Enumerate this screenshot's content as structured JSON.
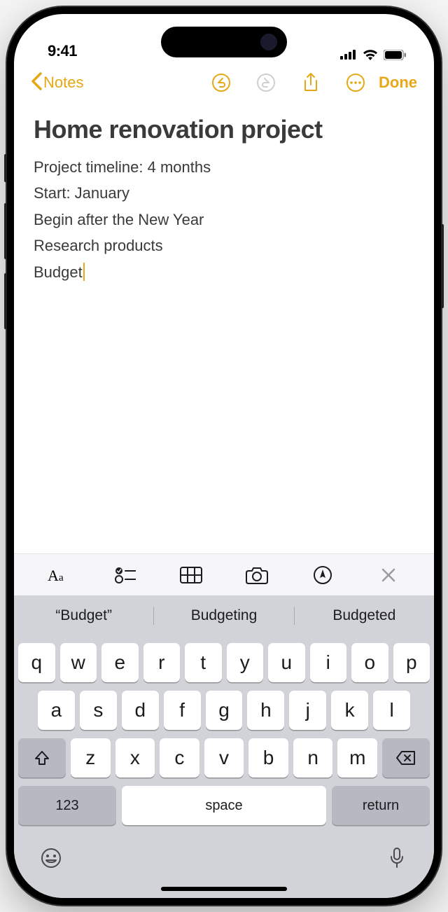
{
  "status": {
    "time": "9:41"
  },
  "nav": {
    "back_label": "Notes",
    "done_label": "Done"
  },
  "note": {
    "title": "Home renovation project",
    "lines": [
      "Project timeline: 4 months",
      "Start: January",
      "Begin after the New Year",
      "Research products",
      "Budget"
    ]
  },
  "suggestions": [
    "“Budget”",
    "Budgeting",
    "Budgeted"
  ],
  "keyboard": {
    "row1": [
      "q",
      "w",
      "e",
      "r",
      "t",
      "y",
      "u",
      "i",
      "o",
      "p"
    ],
    "row2": [
      "a",
      "s",
      "d",
      "f",
      "g",
      "h",
      "j",
      "k",
      "l"
    ],
    "row3": [
      "z",
      "x",
      "c",
      "v",
      "b",
      "n",
      "m"
    ],
    "numbers_label": "123",
    "space_label": "space",
    "return_label": "return"
  },
  "colors": {
    "accent": "#e6a817"
  }
}
